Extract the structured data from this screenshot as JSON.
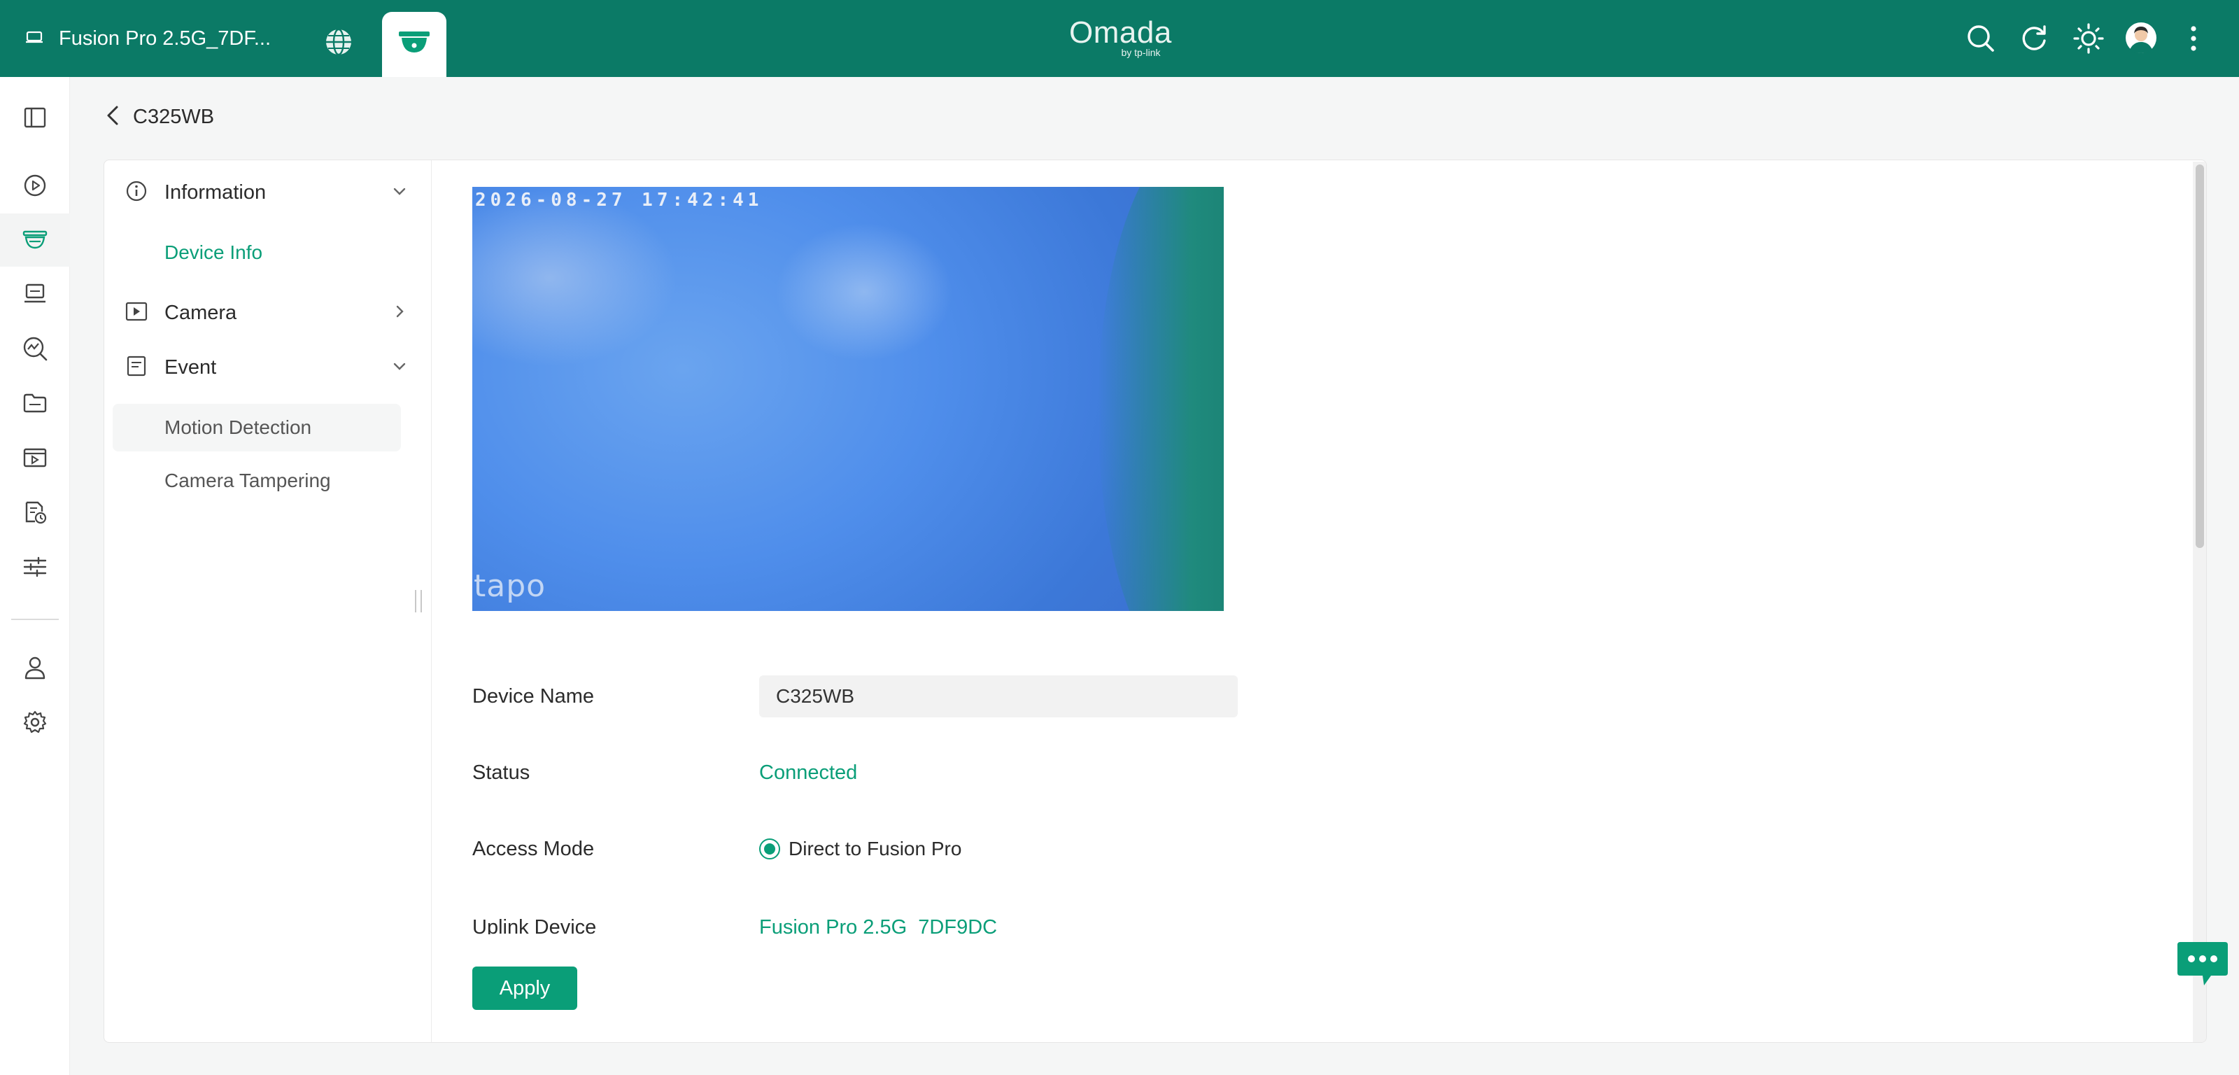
{
  "topbar": {
    "device_name": "Fusion Pro 2.5G_7DF...",
    "logo_text": "Omada",
    "logo_sub": "by tp-link",
    "icons": [
      "router-icon",
      "globe-icon",
      "camera-icon",
      "search-icon",
      "refresh-icon",
      "theme-icon",
      "avatar-icon",
      "more-icon"
    ],
    "accent_color": "#0b7a66"
  },
  "rail": {
    "items": [
      "sidebar-toggle-icon",
      "dashboard-icon",
      "surveillance-icon",
      "devices-icon",
      "insights-icon",
      "files-icon",
      "playback-icon",
      "logs-icon",
      "settings-sliders-icon",
      "user-icon",
      "gear-icon"
    ]
  },
  "breadcrumb": {
    "title": "C325WB"
  },
  "subnav": {
    "information": "Information",
    "device_info": "Device Info",
    "camera": "Camera",
    "event": "Event",
    "motion_detection": "Motion Detection",
    "camera_tampering": "Camera Tampering"
  },
  "video": {
    "timestamp": "2026-08-27  17:42:41",
    "watermark": "tapo"
  },
  "form": {
    "device_name_label": "Device Name",
    "device_name_value": "C325WB",
    "status_label": "Status",
    "status_value": "Connected",
    "access_mode_label": "Access Mode",
    "access_mode_value": "Direct to Fusion Pro",
    "uplink_label": "Uplink Device",
    "uplink_value": "Fusion Pro 2.5G_7DF9DC"
  },
  "actions": {
    "apply": "Apply"
  },
  "colors": {
    "brand_green": "#0a9e78"
  }
}
